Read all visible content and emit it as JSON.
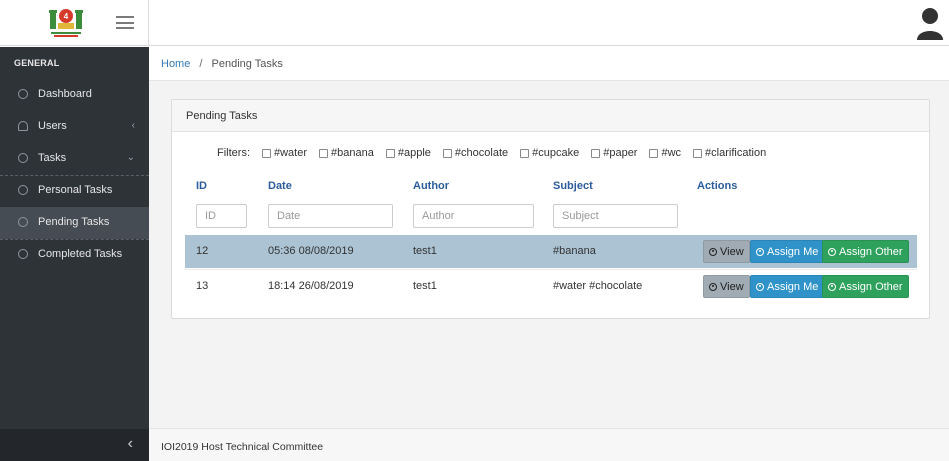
{
  "header": {
    "logo": "ioi2019-logo",
    "menu_icon": "hamburger-icon",
    "user_icon": "user-avatar-icon"
  },
  "sidebar": {
    "section": "GENERAL",
    "items": [
      {
        "label": "Dashboard",
        "icon": "dashboard-icon",
        "arrow": ""
      },
      {
        "label": "Users",
        "icon": "user-icon",
        "arrow": "‹"
      },
      {
        "label": "Tasks",
        "icon": "check-circle-icon",
        "arrow": "⌄"
      },
      {
        "label": "Personal Tasks",
        "icon": "check-circle-icon",
        "arrow": ""
      },
      {
        "label": "Pending Tasks",
        "icon": "check-circle-icon",
        "arrow": ""
      },
      {
        "label": "Completed Tasks",
        "icon": "check-circle-icon",
        "arrow": ""
      }
    ],
    "collapse_icon": "‹"
  },
  "breadcrumb": {
    "home": "Home",
    "separator": "/",
    "current": "Pending Tasks"
  },
  "panel": {
    "title": "Pending Tasks",
    "filters_label": "Filters:",
    "filters": [
      "#water",
      "#banana",
      "#apple",
      "#chocolate",
      "#cupcake",
      "#paper",
      "#wc",
      "#clarification"
    ],
    "columns": {
      "id": "ID",
      "date": "Date",
      "author": "Author",
      "subject": "Subject",
      "actions": "Actions"
    },
    "placeholders": {
      "id": "ID",
      "date": "Date",
      "author": "Author",
      "subject": "Subject"
    },
    "rows": [
      {
        "id": "12",
        "date": "05:36 08/08/2019",
        "author": "test1",
        "subject": "#banana",
        "highlighted": true
      },
      {
        "id": "13",
        "date": "18:14 26/08/2019",
        "author": "test1",
        "subject": "#water #chocolate",
        "highlighted": false
      }
    ],
    "buttons": {
      "view": "View",
      "assign_me": "Assign Me",
      "assign_other": "Assign Other"
    }
  },
  "footer": {
    "text": "IOI2019 Host Technical Committee"
  },
  "colors": {
    "sidebar": "#2e3338",
    "active": "#454c53",
    "link": "#337ab7",
    "highlight_row": "#abc3d3",
    "btn_blue": "#2f93c9",
    "btn_green": "#2ea15d"
  }
}
